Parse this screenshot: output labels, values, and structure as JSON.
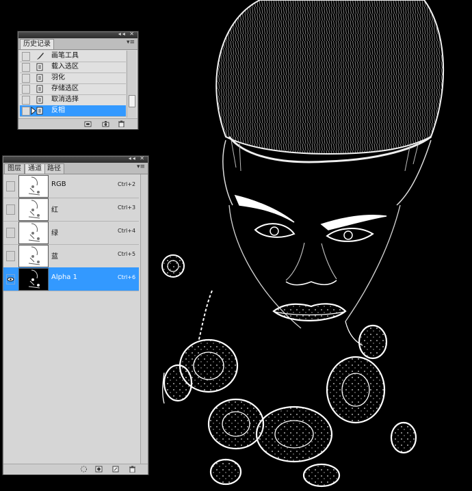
{
  "history_panel": {
    "tab": "历史记录",
    "items": [
      {
        "label": "画笔工具",
        "icon": "brush-icon",
        "selected": false
      },
      {
        "label": "载入选区",
        "icon": "history-step-icon",
        "selected": false
      },
      {
        "label": "羽化",
        "icon": "history-step-icon",
        "selected": false
      },
      {
        "label": "存储选区",
        "icon": "history-step-icon",
        "selected": false
      },
      {
        "label": "取消选择",
        "icon": "history-step-icon",
        "selected": false
      },
      {
        "label": "反相",
        "icon": "history-step-icon",
        "selected": true
      }
    ],
    "bottom_buttons": [
      "new-document-from-state-icon",
      "snapshot-camera-icon",
      "trash-icon"
    ]
  },
  "channels_panel": {
    "tabs": [
      {
        "label": "图层",
        "active": false
      },
      {
        "label": "通道",
        "active": true
      },
      {
        "label": "路径",
        "active": false
      }
    ],
    "channels": [
      {
        "label": "RGB",
        "shortcut": "Ctrl+2",
        "visible": false,
        "selected": false
      },
      {
        "label": "红",
        "shortcut": "Ctrl+3",
        "visible": false,
        "selected": false
      },
      {
        "label": "绿",
        "shortcut": "Ctrl+4",
        "visible": false,
        "selected": false
      },
      {
        "label": "蓝",
        "shortcut": "Ctrl+5",
        "visible": false,
        "selected": false
      },
      {
        "label": "Alpha 1",
        "shortcut": "Ctrl+6",
        "visible": true,
        "selected": true
      }
    ],
    "bottom_buttons": [
      "load-channel-selection-icon",
      "save-selection-channel-icon",
      "new-channel-icon",
      "trash-icon"
    ]
  },
  "colors": {
    "selection": "#3399ff",
    "panel_bg": "#d6d6d6",
    "canvas_bg": "#000000",
    "canvas_stroke": "#ffffff"
  }
}
